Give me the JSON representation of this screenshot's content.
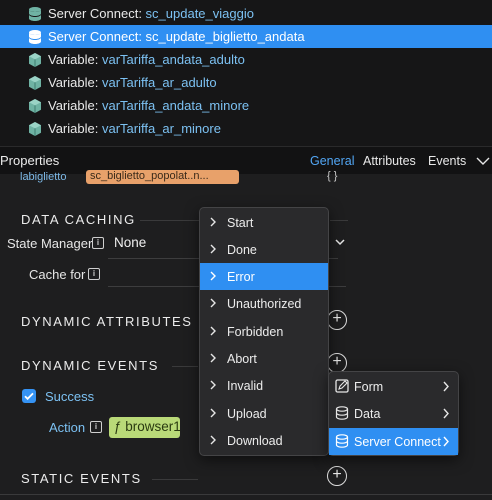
{
  "tree": {
    "items": [
      {
        "kind": "Server Connect: ",
        "value": "sc_update_viaggio",
        "icon": "database-icon"
      },
      {
        "kind": "Server Connect: ",
        "value": "sc_update_biglietto_andata",
        "icon": "database-icon",
        "selected": true
      },
      {
        "kind": "Variable: ",
        "value": "varTariffa_andata_adulto",
        "icon": "cube-icon"
      },
      {
        "kind": "Variable: ",
        "value": "varTariffa_ar_adulto",
        "icon": "cube-icon"
      },
      {
        "kind": "Variable: ",
        "value": "varTariffa_andata_minore",
        "icon": "cube-icon"
      },
      {
        "kind": "Variable: ",
        "value": "varTariffa_ar_minore",
        "icon": "cube-icon"
      }
    ]
  },
  "properties": {
    "title": "Properties",
    "tabs": [
      "General",
      "Attributes",
      "Events"
    ],
    "active_tab": "General",
    "cut_label": "labiglietto",
    "cut_value": "sc_biglietto_popolat..n...",
    "cut_brace": "{ }"
  },
  "data_caching": {
    "title": "DATA CACHING",
    "state_manager_label": "State Manager",
    "state_manager_value": "None",
    "cache_for_label": "Cache for"
  },
  "dynamic_attributes": {
    "title": "DYNAMIC ATTRIBUTES"
  },
  "dynamic_events": {
    "title": "DYNAMIC EVENTS",
    "event_label": "Success",
    "action_label": "Action",
    "action_value": "ƒ browser1"
  },
  "static_events": {
    "title": "STATIC EVENTS"
  },
  "event_menu": {
    "items": [
      "Start",
      "Done",
      "Error",
      "Unauthorized",
      "Forbidden",
      "Abort",
      "Invalid",
      "Upload",
      "Download"
    ],
    "highlighted": "Error"
  },
  "action_menu": {
    "items": [
      {
        "label": "Form",
        "icon": "form-icon"
      },
      {
        "label": "Data",
        "icon": "database-icon"
      },
      {
        "label": "Server Connect",
        "icon": "database-icon",
        "highlight": true
      }
    ]
  },
  "colors": {
    "accent": "#2f8ff2",
    "link_text": "#7cc1f2",
    "cube_icon": "#6fb3a4",
    "action_chip": "#b9d978",
    "field_orange": "#e8a16a"
  }
}
